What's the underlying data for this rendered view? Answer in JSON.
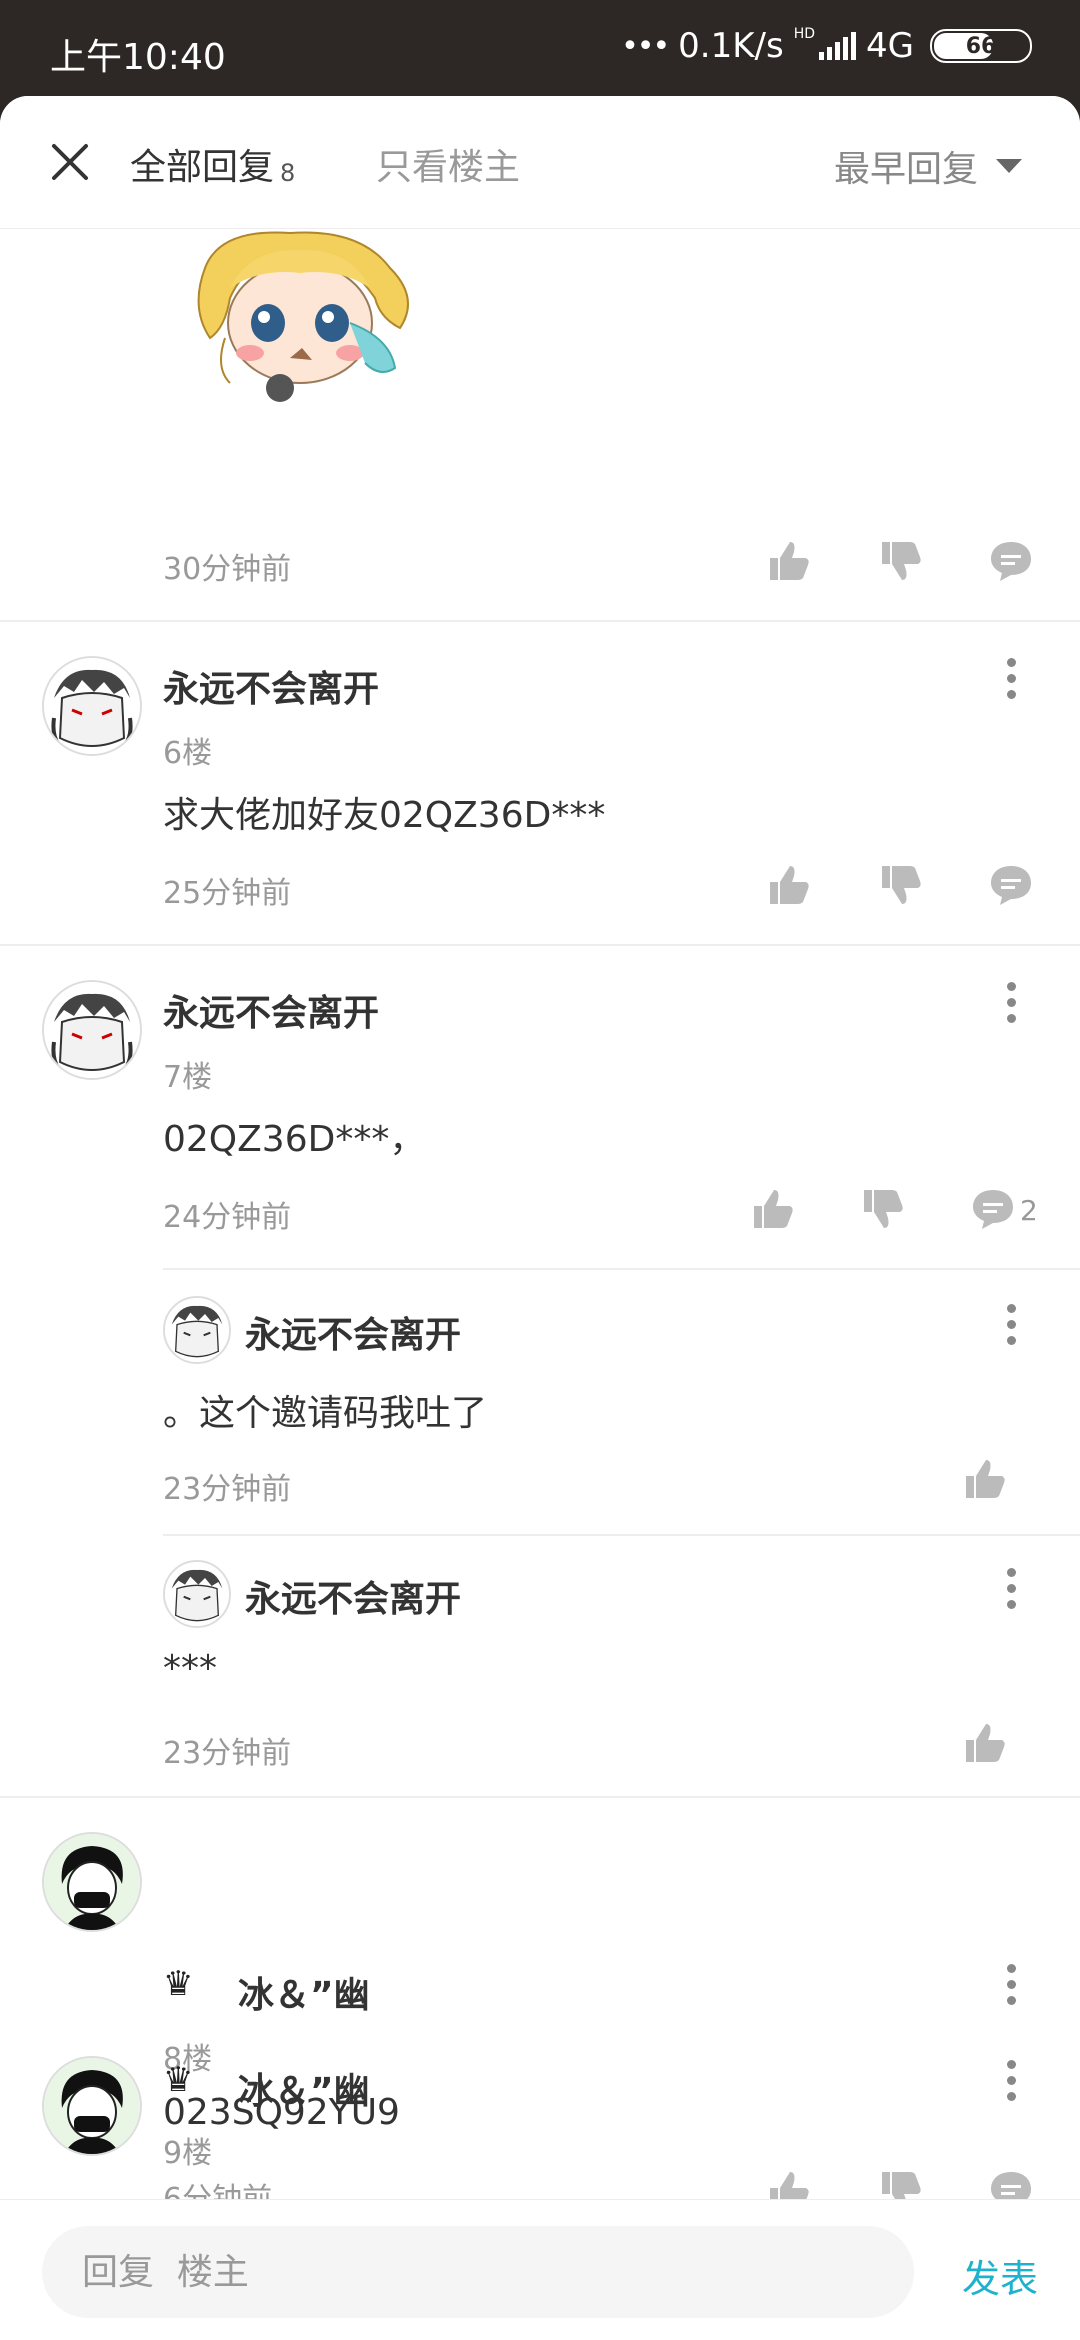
{
  "status_bar": {
    "time": "上午10:40",
    "dots": "•••",
    "speed": "0.1K/s",
    "hd": "HD",
    "network": "4G",
    "battery": "66"
  },
  "header": {
    "tab_all_label": "全部回复",
    "tab_all_count": "8",
    "tab_op_label": "只看楼主",
    "sort_label": "最早回复"
  },
  "comments": [
    {
      "time": "30分钟前"
    },
    {
      "username": "永远不会离开",
      "floor": "6楼",
      "text": "求大佬加好友02QZ36D***",
      "time": "25分钟前"
    },
    {
      "username": "永远不会离开",
      "floor": "7楼",
      "text": "02QZ36D***，",
      "time": "24分钟前",
      "reply_count": "2",
      "replies": [
        {
          "username": "永远不会离开",
          "text": "。这个邀请码我吐了",
          "time": "23分钟前"
        },
        {
          "username": "永远不会离开",
          "text": "***",
          "time": "23分钟前"
        }
      ]
    },
    {
      "username": "冰＆”幽",
      "floor": "8楼",
      "text": "023SQ92YU9",
      "time": "6分钟前",
      "crown": "♛"
    },
    {
      "username": "冰＆”幽",
      "floor": "9楼",
      "crown": "♛"
    }
  ],
  "bottom_bar": {
    "placeholder": "回复  楼主",
    "send_label": "发表"
  },
  "colors": {
    "accent": "#1fb2cc",
    "statusbar_bg": "#2d2826"
  }
}
